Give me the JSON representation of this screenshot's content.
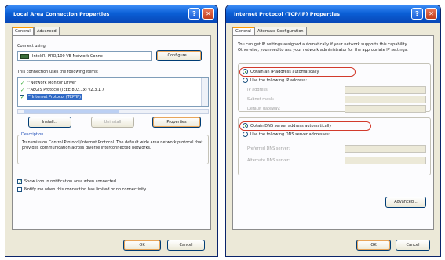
{
  "left_dialog": {
    "title": "Local Area Connection Properties",
    "tabs": [
      "General",
      "Advanced"
    ],
    "connect_using_label": "Connect using:",
    "adapter_name": "Intel(R) PRO/100 VE Network Conne",
    "configure_label": "Configure...",
    "items_label": "This connection uses the following items:",
    "items": [
      {
        "label": "\"\"Network Monitor Driver",
        "checked": true,
        "selected": false
      },
      {
        "label": "\"\"AEGIS Protocol (IEEE 802.1x) v2.3.1.7",
        "checked": true,
        "selected": false
      },
      {
        "label": "\"\"Internet Protocol (TCP/IP)",
        "checked": true,
        "selected": true
      }
    ],
    "install_label": "Install...",
    "uninstall_label": "Uninstall",
    "properties_label": "Properties",
    "description_title": "Description",
    "description_text": "Transmission Control Protocol/Internet Protocol. The default wide area network protocol that provides communication across diverse interconnected networks.",
    "show_icon_label": "Show icon in notification area when connected",
    "notify_label": "Notify me when this connection has limited or no connectivity",
    "show_icon_checked": true,
    "notify_checked": false,
    "ok_label": "OK",
    "cancel_label": "Cancel"
  },
  "right_dialog": {
    "title": "Internet Protocol (TCP/IP) Properties",
    "tabs": [
      "General",
      "Alternate Configuration"
    ],
    "intro_text": "You can get IP settings assigned automatically if your network supports this capability. Otherwise, you need to ask your network administrator for the appropriate IP settings.",
    "obtain_ip_label": "Obtain an IP address automatically",
    "use_ip_label": "Use the following IP address:",
    "ip_fields": [
      "IP address:",
      "Subnet mask:",
      "Default gateway:"
    ],
    "obtain_dns_label": "Obtain DNS server address automatically",
    "use_dns_label": "Use the following DNS server addresses:",
    "dns_fields": [
      "Preferred DNS server:",
      "Alternate DNS server:"
    ],
    "advanced_label": "Advanced...",
    "ok_label": "OK",
    "cancel_label": "Cancel"
  },
  "icons": {
    "help": "?",
    "close": "✕"
  },
  "colors": {
    "titlebar": "#0a5fd6",
    "dialog_bg": "#ece9d8",
    "highlight": "#316ac5",
    "callout_ring": "#d23b2c"
  }
}
